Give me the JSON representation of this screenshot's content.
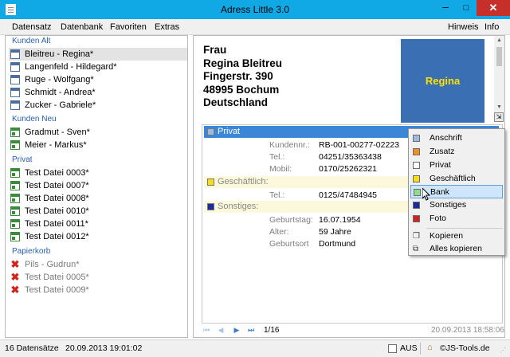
{
  "window": {
    "title": "Adress Little 3.0",
    "minimize": "─",
    "maximize": "□",
    "close": "✕"
  },
  "menu": {
    "items": [
      "Datensatz",
      "Datenbank",
      "Favoriten",
      "Extras"
    ],
    "right_items": [
      "Hinweis",
      "Info"
    ]
  },
  "sidebar": {
    "sections": [
      {
        "title": "Kunden Alt",
        "items": [
          {
            "label": "Bleitreu - Regina*",
            "icon": "card-icon",
            "selected": true
          },
          {
            "label": "Langenfeld - Hildegard*",
            "icon": "card-icon"
          },
          {
            "label": "Ruge - Wolfgang*",
            "icon": "card-icon"
          },
          {
            "label": "Schmidt - Andrea*",
            "icon": "card-icon"
          },
          {
            "label": "Zucker - Gabriele*",
            "icon": "card-icon"
          }
        ]
      },
      {
        "title": "Kunden Neu",
        "items": [
          {
            "label": "Gradmut - Sven*",
            "icon": "card-green-icon"
          },
          {
            "label": "Meier - Markus*",
            "icon": "card-green-icon"
          }
        ]
      },
      {
        "title": "Privat",
        "items": [
          {
            "label": "Test Datei 0003*",
            "icon": "card-green-icon"
          },
          {
            "label": "Test Datei 0007*",
            "icon": "card-green-icon"
          },
          {
            "label": "Test Datei 0008*",
            "icon": "card-green-icon"
          },
          {
            "label": "Test Datei 0010*",
            "icon": "card-green-icon"
          },
          {
            "label": "Test Datei 0011*",
            "icon": "card-green-icon"
          },
          {
            "label": "Test Datei 0012*",
            "icon": "card-green-icon"
          }
        ]
      },
      {
        "title": "Papierkorb",
        "items": [
          {
            "label": "Pils - Gudrun*",
            "icon": "delete-icon"
          },
          {
            "label": "Test Datei 0005*",
            "icon": "delete-icon"
          },
          {
            "label": "Test Datei 0009*",
            "icon": "delete-icon"
          }
        ]
      }
    ]
  },
  "address": {
    "salutation": "Frau",
    "name": "Regina Bleitreu",
    "street": "Fingerstr. 390",
    "city": "48995 Bochum",
    "country": "Deutschland"
  },
  "photo": {
    "label": "Regina",
    "bg": "#3b6fb3",
    "fg": "#ffe000"
  },
  "detail": {
    "categories": [
      {
        "label": "Privat",
        "swatch": "#9dbbe0",
        "style": "selected"
      },
      {
        "label": "Geschäftlich:",
        "swatch": "#f5df1c",
        "style": "yellow"
      },
      {
        "label": "Sonstiges:",
        "swatch": "#1a2b9a",
        "style": "yellow"
      }
    ],
    "fields": [
      {
        "label": "Kundennr.:",
        "value": "RB-001-00277-02223"
      },
      {
        "label": "Tel.:",
        "value": "04251/35363438"
      },
      {
        "label": "Mobil:",
        "value": "0170/25262321"
      },
      {
        "label": "Tel.:",
        "value": "0125/47484945"
      },
      {
        "label": "Geburtstag:",
        "value": "16.07.1954"
      },
      {
        "label": "Alter:",
        "value": "59 Jahre"
      },
      {
        "label": "Geburtsort",
        "value": "Dortmund"
      }
    ]
  },
  "navigation": {
    "page": "1/16",
    "timestamp": "20.09.2013  18:58:06"
  },
  "context_menu": {
    "items": [
      {
        "label": "Anschrift",
        "swatch": "#9dbbe0"
      },
      {
        "label": "Zusatz",
        "swatch": "#ef8f25"
      },
      {
        "label": "Privat",
        "swatch": "#ffffff"
      },
      {
        "label": "Geschäftlich",
        "swatch": "#f5df1c"
      },
      {
        "label": "Bank",
        "swatch": "#8fdc8a",
        "highlighted": true
      },
      {
        "label": "Sonstiges",
        "swatch": "#1a2b9a"
      },
      {
        "label": "Foto",
        "swatch": "#d0251e"
      }
    ],
    "actions": [
      {
        "label": "Kopieren",
        "icon": "copy-icon"
      },
      {
        "label": "Alles kopieren",
        "icon": "copy-all-icon"
      }
    ]
  },
  "statusbar": {
    "count": "16 Datensätze",
    "datetime": "20.09.2013 19:01:02",
    "checkbox_label": "AUS",
    "copyright": "©JS-Tools.de"
  }
}
